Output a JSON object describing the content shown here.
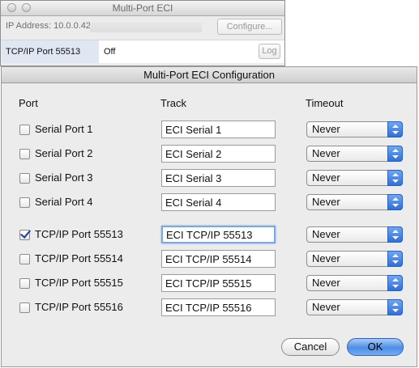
{
  "background_window": {
    "title": "Multi-Port ECI",
    "ip_label": "IP Address: 10.0.0.42",
    "configure_label": "Configure...",
    "row": {
      "port": "TCP/IP Port 55513",
      "status": "Off",
      "log_label": "Log"
    }
  },
  "sheet": {
    "title": "Multi-Port ECI Configuration",
    "headers": {
      "port": "Port",
      "track": "Track",
      "timeout": "Timeout"
    },
    "rows": [
      {
        "port": "Serial Port 1",
        "checked": false,
        "track": "ECI Serial 1",
        "timeout": "Never"
      },
      {
        "port": "Serial Port 2",
        "checked": false,
        "track": "ECI Serial 2",
        "timeout": "Never"
      },
      {
        "port": "Serial Port 3",
        "checked": false,
        "track": "ECI Serial 3",
        "timeout": "Never"
      },
      {
        "port": "Serial Port 4",
        "checked": false,
        "track": "ECI Serial 4",
        "timeout": "Never"
      },
      {
        "port": "TCP/IP Port 55513",
        "checked": true,
        "track": "ECI TCP/IP 55513",
        "timeout": "Never"
      },
      {
        "port": "TCP/IP Port 55514",
        "checked": false,
        "track": "ECI TCP/IP 55514",
        "timeout": "Never"
      },
      {
        "port": "TCP/IP Port 55515",
        "checked": false,
        "track": "ECI TCP/IP 55515",
        "timeout": "Never"
      },
      {
        "port": "TCP/IP Port 55516",
        "checked": false,
        "track": "ECI TCP/IP 55516",
        "timeout": "Never"
      }
    ],
    "buttons": {
      "cancel": "Cancel",
      "ok": "OK"
    }
  },
  "colors": {
    "accent": "#4c8fe8",
    "selection": "#dfe7f2"
  }
}
